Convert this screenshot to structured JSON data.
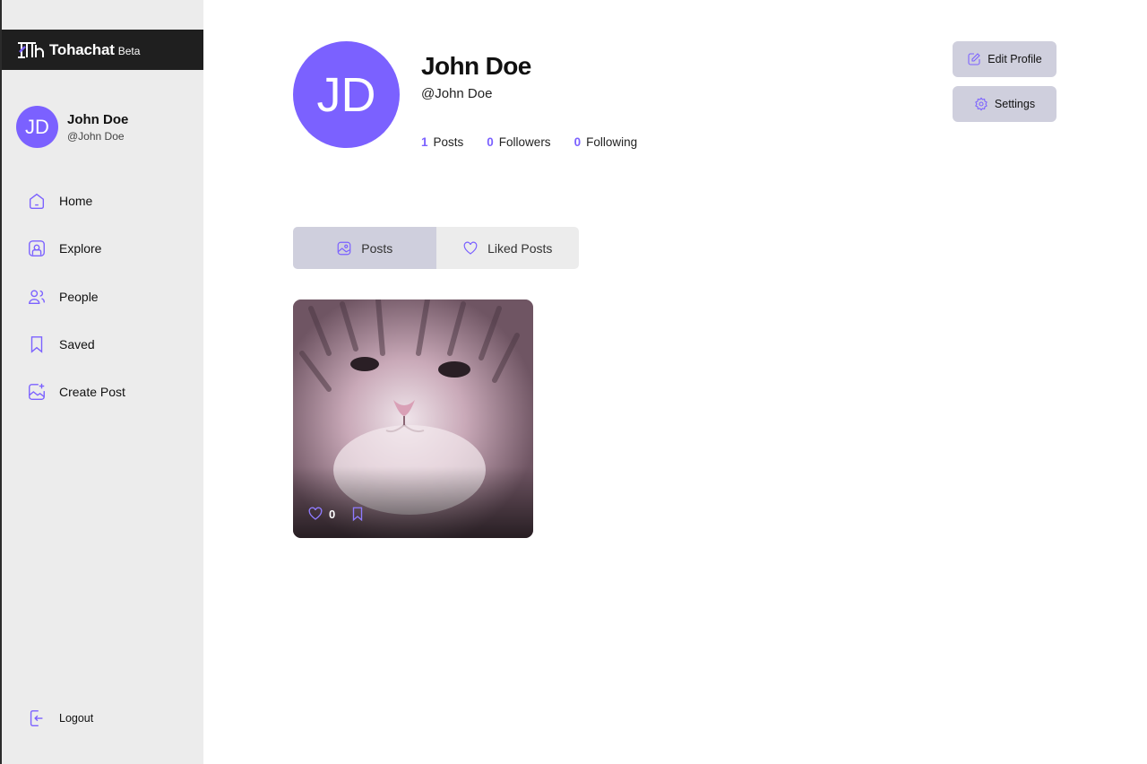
{
  "brand": {
    "name": "Tohachat",
    "badge": "Beta",
    "logo_icon": "tohachat-logo-icon"
  },
  "colors": {
    "accent": "#7b61ff",
    "sidebar_bg": "#ececec",
    "brand_bg": "#1f1f1f",
    "button_bg": "#cfcfdd"
  },
  "sidebar": {
    "user": {
      "initials": "JD",
      "name": "John Doe",
      "handle": "@John Doe"
    },
    "items": [
      {
        "label": "Home",
        "icon": "home-icon"
      },
      {
        "label": "Explore",
        "icon": "explore-icon"
      },
      {
        "label": "People",
        "icon": "people-icon"
      },
      {
        "label": "Saved",
        "icon": "bookmark-icon"
      },
      {
        "label": "Create Post",
        "icon": "add-image-icon"
      }
    ],
    "logout": {
      "label": "Logout",
      "icon": "logout-icon"
    }
  },
  "profile": {
    "initials": "JD",
    "name": "John Doe",
    "handle": "@John Doe",
    "stats": [
      {
        "value": "1",
        "label": "Posts"
      },
      {
        "value": "0",
        "label": "Followers"
      },
      {
        "value": "0",
        "label": "Following"
      }
    ],
    "edit_label": "Edit Profile",
    "settings_label": "Settings"
  },
  "tabs": [
    {
      "label": "Posts",
      "icon": "image-icon",
      "active": true
    },
    {
      "label": "Liked Posts",
      "icon": "heart-icon",
      "active": false
    }
  ],
  "posts": [
    {
      "image": "kitten-photo",
      "likes": "0"
    }
  ]
}
